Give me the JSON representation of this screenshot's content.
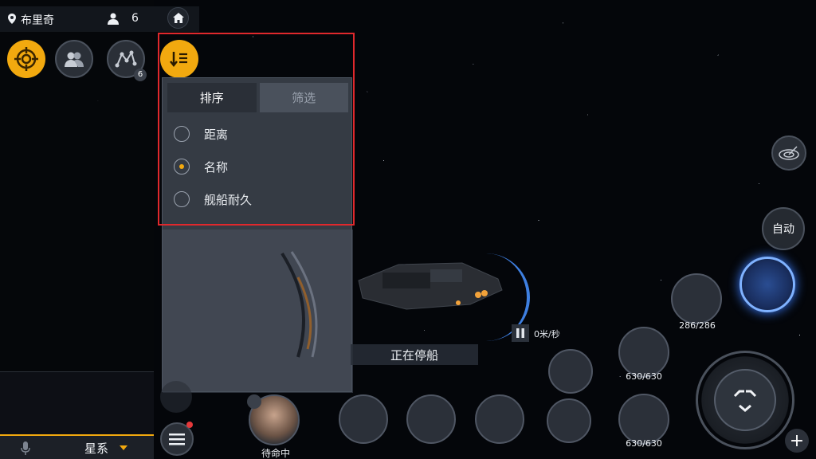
{
  "topbar": {
    "location": "布里奇",
    "online_count": "6"
  },
  "left_buttons": {
    "route_badge": "6"
  },
  "sort_panel": {
    "tabs": [
      {
        "label": "排序",
        "active": true
      },
      {
        "label": "筛选",
        "active": false
      }
    ],
    "options": [
      {
        "label": "距离",
        "checked": false
      },
      {
        "label": "名称",
        "checked": true
      },
      {
        "label": "舰船耐久",
        "checked": false
      }
    ]
  },
  "ship_status": {
    "speed": "0米/秒",
    "status": "正在停船"
  },
  "right_controls": {
    "auto_label": "自动",
    "units": [
      {
        "label": "286/286"
      },
      {
        "label": "630/630"
      },
      {
        "label": "630/630"
      }
    ]
  },
  "bottom": {
    "channel": "星系",
    "captain_status": "待命中"
  },
  "colors": {
    "accent": "#f2a90f",
    "highlight": "#e0282c",
    "selected_ship": "#7fb2ff"
  },
  "icons": {
    "location": "location-pin-icon",
    "person": "person-icon",
    "home": "home-icon",
    "target": "target-icon",
    "team": "team-icon",
    "route": "route-icon",
    "sort": "sort-icon",
    "mic": "microphone-icon",
    "menu": "menu-icon",
    "scan": "scan-icon"
  }
}
